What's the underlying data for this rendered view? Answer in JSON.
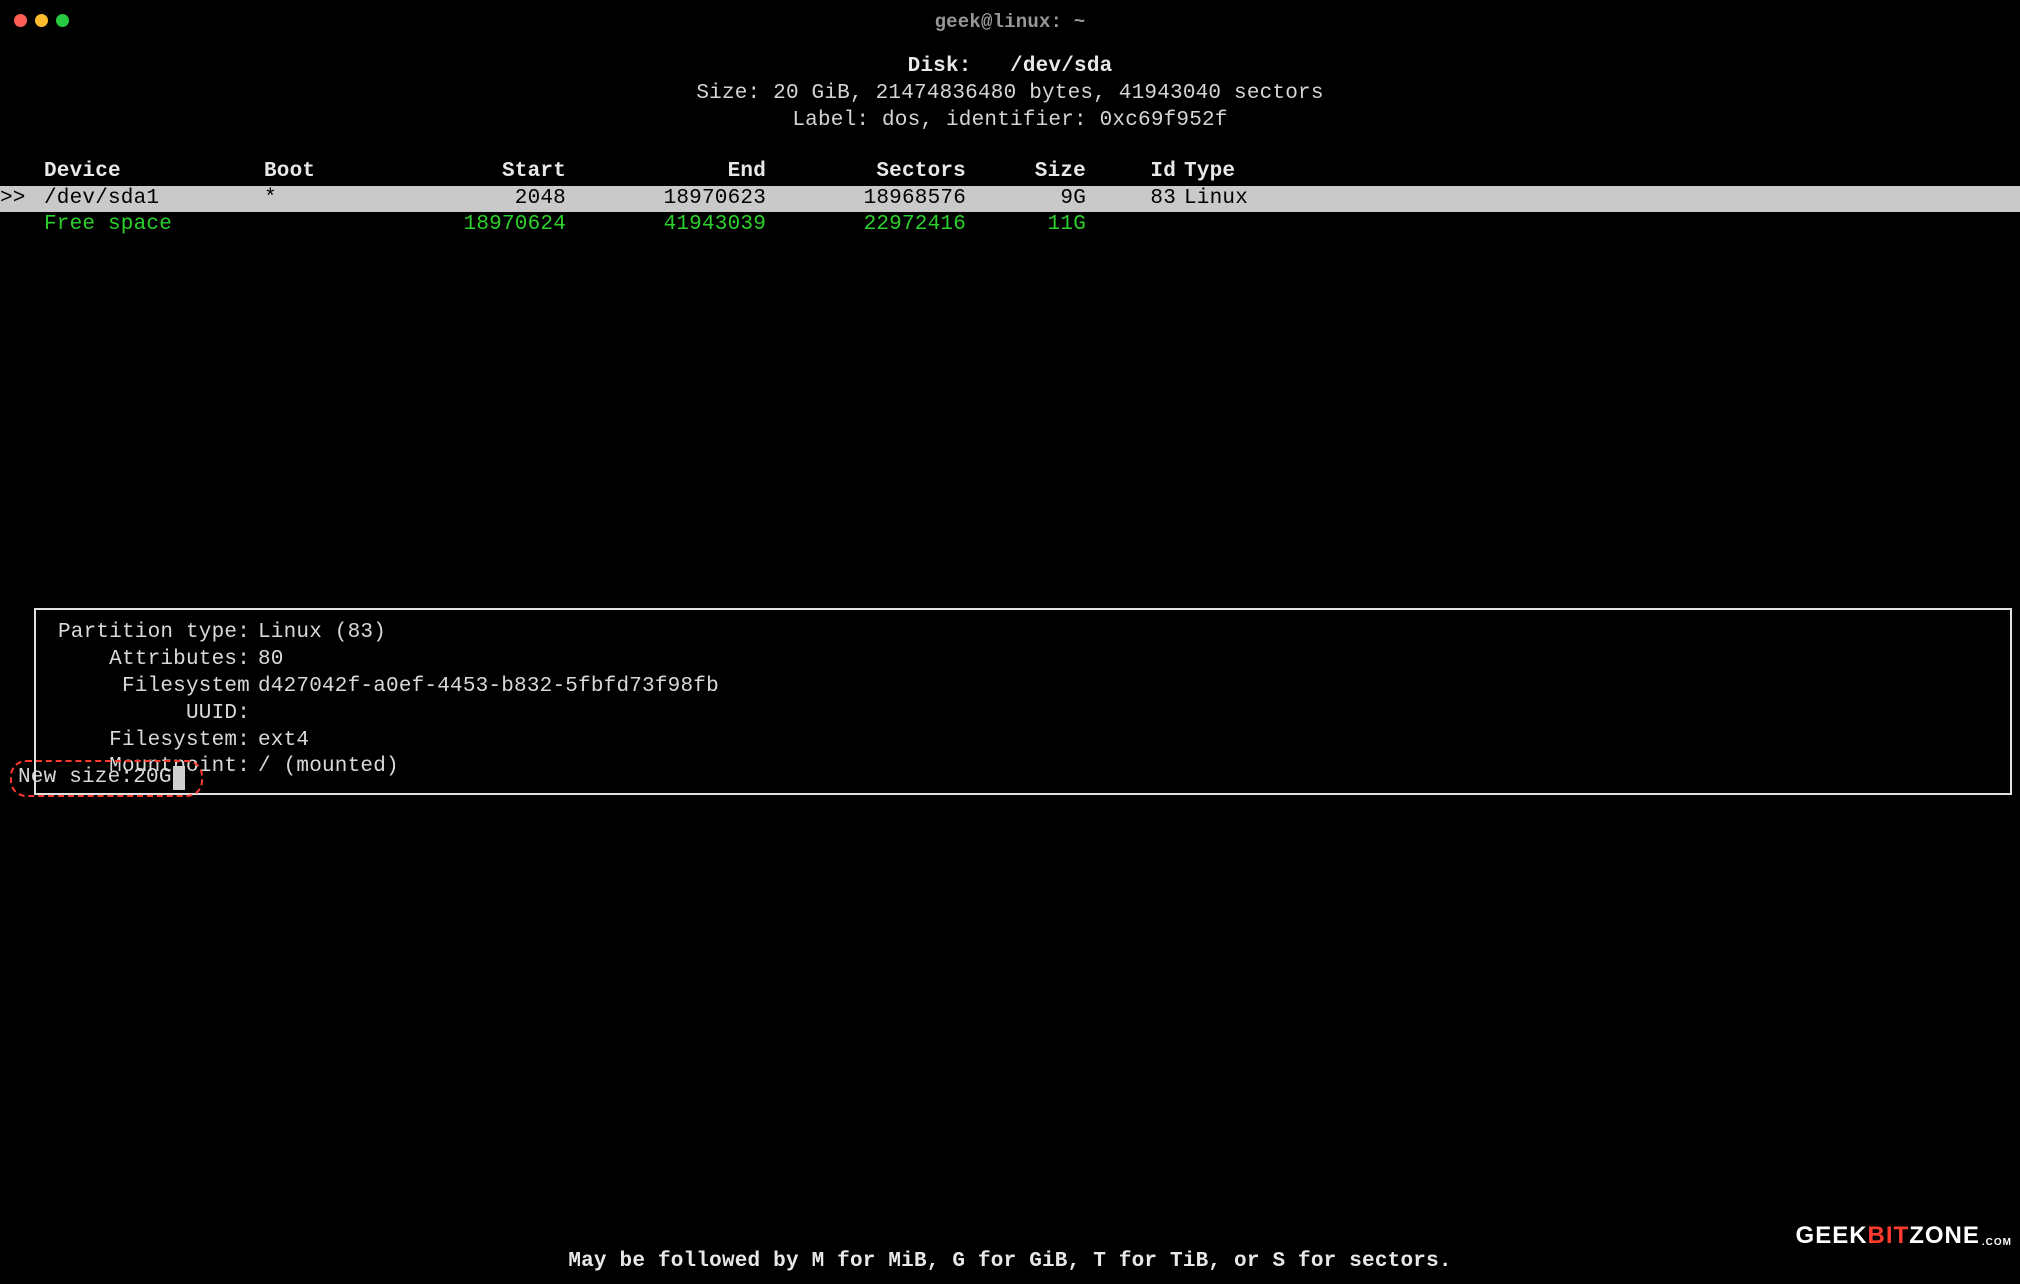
{
  "titlebar": {
    "title": "geek@linux: ~"
  },
  "header": {
    "disk_label": "Disk:",
    "disk_path": "/dev/sda",
    "size_line": "Size: 20 GiB, 21474836480 bytes, 41943040 sectors",
    "label_line": "Label: dos, identifier: 0xc69f952f"
  },
  "columns": {
    "device": "Device",
    "boot": "Boot",
    "start": "Start",
    "end": "End",
    "sectors": "Sectors",
    "size": "Size",
    "id": "Id",
    "type": "Type"
  },
  "rows": {
    "selected_marker": ">>",
    "sda1": {
      "device": "/dev/sda1",
      "boot": "*",
      "start": "2048",
      "end": "18970623",
      "sectors": "18968576",
      "size": "9G",
      "id": "83",
      "type": "Linux"
    },
    "free": {
      "device": "Free space",
      "start": "18970624",
      "end": "41943039",
      "sectors": "22972416",
      "size": "11G"
    }
  },
  "info": {
    "ptype_label": "Partition type:",
    "ptype_value": "Linux (83)",
    "attrs_label": "Attributes:",
    "attrs_value": "80",
    "uuid_label": "Filesystem UUID:",
    "uuid_value": "d427042f-a0ef-4453-b832-5fbfd73f98fb",
    "fs_label": "Filesystem:",
    "fs_value": "ext4",
    "mp_label": "Mountpoint:",
    "mp_value": "/ (mounted)"
  },
  "prompt": {
    "label": "New size: ",
    "value": "20G"
  },
  "hint": "May be followed by M for MiB, G for GiB, T for TiB, or S for sectors.",
  "watermark": {
    "a": "GEEK",
    "b": "BIT",
    "c": "ZONE",
    "d": ".COM"
  }
}
